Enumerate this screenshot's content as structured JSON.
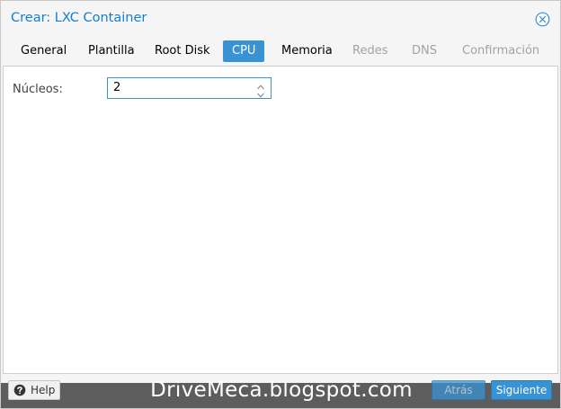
{
  "window": {
    "title": "Crear: LXC Container"
  },
  "tabs": [
    {
      "label": "General",
      "state": "normal"
    },
    {
      "label": "Plantilla",
      "state": "normal"
    },
    {
      "label": "Root Disk",
      "state": "normal"
    },
    {
      "label": "CPU",
      "state": "active"
    },
    {
      "label": "Memoria",
      "state": "normal"
    },
    {
      "label": "Redes",
      "state": "disabled"
    },
    {
      "label": "DNS",
      "state": "disabled"
    },
    {
      "label": "Confirmación",
      "state": "disabled"
    }
  ],
  "cpu": {
    "cores_label": "Núcleos:",
    "cores_value": "2"
  },
  "footer": {
    "help_label": "Help",
    "back_label": "Atrás",
    "next_label": "Siguiente"
  },
  "watermark": {
    "text": "DriveMeca.blogspot.com"
  },
  "icons": {
    "close": "close-circle-icon",
    "help": "question-circle-icon",
    "spin_up": "chevron-up-icon",
    "spin_down": "chevron-down-icon"
  },
  "colors": {
    "accent": "#3892d4",
    "title": "#157fcc",
    "disabled_text": "#a2a2a2"
  }
}
